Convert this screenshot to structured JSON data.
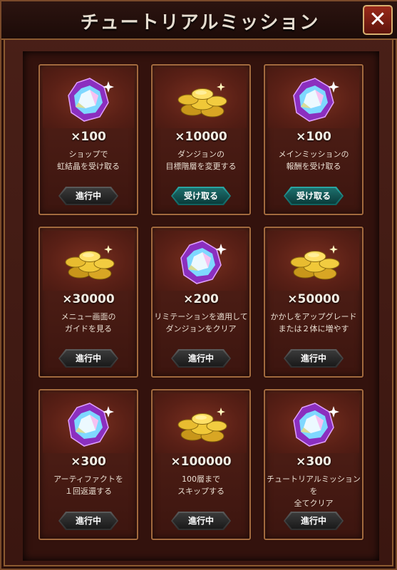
{
  "header": {
    "title": "チュートリアルミッション"
  },
  "close_button": {
    "label": "✕"
  },
  "colors": {
    "accent_gold": "#a26a3e",
    "receive_button": "#2aa8a4",
    "progress_button": "#3a3a3a"
  },
  "missions": [
    {
      "icon": "gem-icon",
      "reward": "×100",
      "description": "ショップで\n虹結晶を受け取る",
      "button": "進行中",
      "status": "progress"
    },
    {
      "icon": "gold-coins-icon",
      "reward": "×10000",
      "description": "ダンジョンの\n目標階層を変更する",
      "button": "受け取る",
      "status": "receive"
    },
    {
      "icon": "gem-icon",
      "reward": "×100",
      "description": "メインミッションの\n報酬を受け取る",
      "button": "受け取る",
      "status": "receive"
    },
    {
      "icon": "gold-coins-icon",
      "reward": "×30000",
      "description": "メニュー画面の\nガイドを見る",
      "button": "進行中",
      "status": "progress"
    },
    {
      "icon": "gem-icon",
      "reward": "×200",
      "description": "リミテーションを適用して\nダンジョンをクリア",
      "button": "進行中",
      "status": "progress"
    },
    {
      "icon": "gold-coins-icon",
      "reward": "×50000",
      "description": "かかしをアップグレード\nまたは２体に増やす",
      "button": "進行中",
      "status": "progress"
    },
    {
      "icon": "gem-icon",
      "reward": "×300",
      "description": "アーティファクトを\n１回返還する",
      "button": "進行中",
      "status": "progress"
    },
    {
      "icon": "gold-coins-icon",
      "reward": "×100000",
      "description": "100層まで\nスキップする",
      "button": "進行中",
      "status": "progress"
    },
    {
      "icon": "gem-icon",
      "reward": "×300",
      "description": "チュートリアルミッションを\n全てクリア",
      "button": "進行中",
      "status": "progress"
    }
  ]
}
